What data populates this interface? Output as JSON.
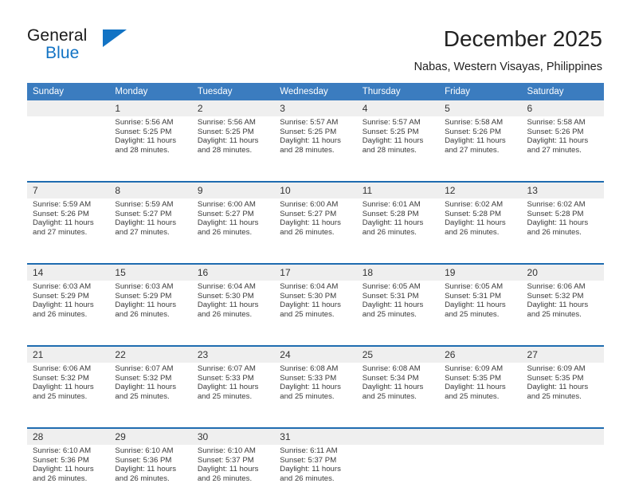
{
  "logo": {
    "word_top": "General",
    "word_bottom": "Blue",
    "triangle_color": "#1273c4",
    "icon": "triangle-logo-icon"
  },
  "header": {
    "title": "December 2025",
    "subtitle": "Nabas, Western Visayas, Philippines"
  },
  "colors": {
    "header_band": "#3b7cbf",
    "week_rule": "#1f6cb0",
    "daynum_strip": "#efefef",
    "brand_blue": "#1273c4"
  },
  "calendar": {
    "weekday_headers": [
      "Sunday",
      "Monday",
      "Tuesday",
      "Wednesday",
      "Thursday",
      "Friday",
      "Saturday"
    ],
    "weeks": [
      {
        "days": [
          {
            "num": "",
            "sunrise": "",
            "sunset": "",
            "daylight_1": "",
            "daylight_2": ""
          },
          {
            "num": "1",
            "sunrise": "Sunrise: 5:56 AM",
            "sunset": "Sunset: 5:25 PM",
            "daylight_1": "Daylight: 11 hours",
            "daylight_2": "and 28 minutes."
          },
          {
            "num": "2",
            "sunrise": "Sunrise: 5:56 AM",
            "sunset": "Sunset: 5:25 PM",
            "daylight_1": "Daylight: 11 hours",
            "daylight_2": "and 28 minutes."
          },
          {
            "num": "3",
            "sunrise": "Sunrise: 5:57 AM",
            "sunset": "Sunset: 5:25 PM",
            "daylight_1": "Daylight: 11 hours",
            "daylight_2": "and 28 minutes."
          },
          {
            "num": "4",
            "sunrise": "Sunrise: 5:57 AM",
            "sunset": "Sunset: 5:25 PM",
            "daylight_1": "Daylight: 11 hours",
            "daylight_2": "and 28 minutes."
          },
          {
            "num": "5",
            "sunrise": "Sunrise: 5:58 AM",
            "sunset": "Sunset: 5:26 PM",
            "daylight_1": "Daylight: 11 hours",
            "daylight_2": "and 27 minutes."
          },
          {
            "num": "6",
            "sunrise": "Sunrise: 5:58 AM",
            "sunset": "Sunset: 5:26 PM",
            "daylight_1": "Daylight: 11 hours",
            "daylight_2": "and 27 minutes."
          }
        ]
      },
      {
        "days": [
          {
            "num": "7",
            "sunrise": "Sunrise: 5:59 AM",
            "sunset": "Sunset: 5:26 PM",
            "daylight_1": "Daylight: 11 hours",
            "daylight_2": "and 27 minutes."
          },
          {
            "num": "8",
            "sunrise": "Sunrise: 5:59 AM",
            "sunset": "Sunset: 5:27 PM",
            "daylight_1": "Daylight: 11 hours",
            "daylight_2": "and 27 minutes."
          },
          {
            "num": "9",
            "sunrise": "Sunrise: 6:00 AM",
            "sunset": "Sunset: 5:27 PM",
            "daylight_1": "Daylight: 11 hours",
            "daylight_2": "and 26 minutes."
          },
          {
            "num": "10",
            "sunrise": "Sunrise: 6:00 AM",
            "sunset": "Sunset: 5:27 PM",
            "daylight_1": "Daylight: 11 hours",
            "daylight_2": "and 26 minutes."
          },
          {
            "num": "11",
            "sunrise": "Sunrise: 6:01 AM",
            "sunset": "Sunset: 5:28 PM",
            "daylight_1": "Daylight: 11 hours",
            "daylight_2": "and 26 minutes."
          },
          {
            "num": "12",
            "sunrise": "Sunrise: 6:02 AM",
            "sunset": "Sunset: 5:28 PM",
            "daylight_1": "Daylight: 11 hours",
            "daylight_2": "and 26 minutes."
          },
          {
            "num": "13",
            "sunrise": "Sunrise: 6:02 AM",
            "sunset": "Sunset: 5:28 PM",
            "daylight_1": "Daylight: 11 hours",
            "daylight_2": "and 26 minutes."
          }
        ]
      },
      {
        "days": [
          {
            "num": "14",
            "sunrise": "Sunrise: 6:03 AM",
            "sunset": "Sunset: 5:29 PM",
            "daylight_1": "Daylight: 11 hours",
            "daylight_2": "and 26 minutes."
          },
          {
            "num": "15",
            "sunrise": "Sunrise: 6:03 AM",
            "sunset": "Sunset: 5:29 PM",
            "daylight_1": "Daylight: 11 hours",
            "daylight_2": "and 26 minutes."
          },
          {
            "num": "16",
            "sunrise": "Sunrise: 6:04 AM",
            "sunset": "Sunset: 5:30 PM",
            "daylight_1": "Daylight: 11 hours",
            "daylight_2": "and 26 minutes."
          },
          {
            "num": "17",
            "sunrise": "Sunrise: 6:04 AM",
            "sunset": "Sunset: 5:30 PM",
            "daylight_1": "Daylight: 11 hours",
            "daylight_2": "and 25 minutes."
          },
          {
            "num": "18",
            "sunrise": "Sunrise: 6:05 AM",
            "sunset": "Sunset: 5:31 PM",
            "daylight_1": "Daylight: 11 hours",
            "daylight_2": "and 25 minutes."
          },
          {
            "num": "19",
            "sunrise": "Sunrise: 6:05 AM",
            "sunset": "Sunset: 5:31 PM",
            "daylight_1": "Daylight: 11 hours",
            "daylight_2": "and 25 minutes."
          },
          {
            "num": "20",
            "sunrise": "Sunrise: 6:06 AM",
            "sunset": "Sunset: 5:32 PM",
            "daylight_1": "Daylight: 11 hours",
            "daylight_2": "and 25 minutes."
          }
        ]
      },
      {
        "days": [
          {
            "num": "21",
            "sunrise": "Sunrise: 6:06 AM",
            "sunset": "Sunset: 5:32 PM",
            "daylight_1": "Daylight: 11 hours",
            "daylight_2": "and 25 minutes."
          },
          {
            "num": "22",
            "sunrise": "Sunrise: 6:07 AM",
            "sunset": "Sunset: 5:32 PM",
            "daylight_1": "Daylight: 11 hours",
            "daylight_2": "and 25 minutes."
          },
          {
            "num": "23",
            "sunrise": "Sunrise: 6:07 AM",
            "sunset": "Sunset: 5:33 PM",
            "daylight_1": "Daylight: 11 hours",
            "daylight_2": "and 25 minutes."
          },
          {
            "num": "24",
            "sunrise": "Sunrise: 6:08 AM",
            "sunset": "Sunset: 5:33 PM",
            "daylight_1": "Daylight: 11 hours",
            "daylight_2": "and 25 minutes."
          },
          {
            "num": "25",
            "sunrise": "Sunrise: 6:08 AM",
            "sunset": "Sunset: 5:34 PM",
            "daylight_1": "Daylight: 11 hours",
            "daylight_2": "and 25 minutes."
          },
          {
            "num": "26",
            "sunrise": "Sunrise: 6:09 AM",
            "sunset": "Sunset: 5:35 PM",
            "daylight_1": "Daylight: 11 hours",
            "daylight_2": "and 25 minutes."
          },
          {
            "num": "27",
            "sunrise": "Sunrise: 6:09 AM",
            "sunset": "Sunset: 5:35 PM",
            "daylight_1": "Daylight: 11 hours",
            "daylight_2": "and 25 minutes."
          }
        ]
      },
      {
        "days": [
          {
            "num": "28",
            "sunrise": "Sunrise: 6:10 AM",
            "sunset": "Sunset: 5:36 PM",
            "daylight_1": "Daylight: 11 hours",
            "daylight_2": "and 26 minutes."
          },
          {
            "num": "29",
            "sunrise": "Sunrise: 6:10 AM",
            "sunset": "Sunset: 5:36 PM",
            "daylight_1": "Daylight: 11 hours",
            "daylight_2": "and 26 minutes."
          },
          {
            "num": "30",
            "sunrise": "Sunrise: 6:10 AM",
            "sunset": "Sunset: 5:37 PM",
            "daylight_1": "Daylight: 11 hours",
            "daylight_2": "and 26 minutes."
          },
          {
            "num": "31",
            "sunrise": "Sunrise: 6:11 AM",
            "sunset": "Sunset: 5:37 PM",
            "daylight_1": "Daylight: 11 hours",
            "daylight_2": "and 26 minutes."
          },
          {
            "num": "",
            "sunrise": "",
            "sunset": "",
            "daylight_1": "",
            "daylight_2": ""
          },
          {
            "num": "",
            "sunrise": "",
            "sunset": "",
            "daylight_1": "",
            "daylight_2": ""
          },
          {
            "num": "",
            "sunrise": "",
            "sunset": "",
            "daylight_1": "",
            "daylight_2": ""
          }
        ]
      }
    ]
  }
}
